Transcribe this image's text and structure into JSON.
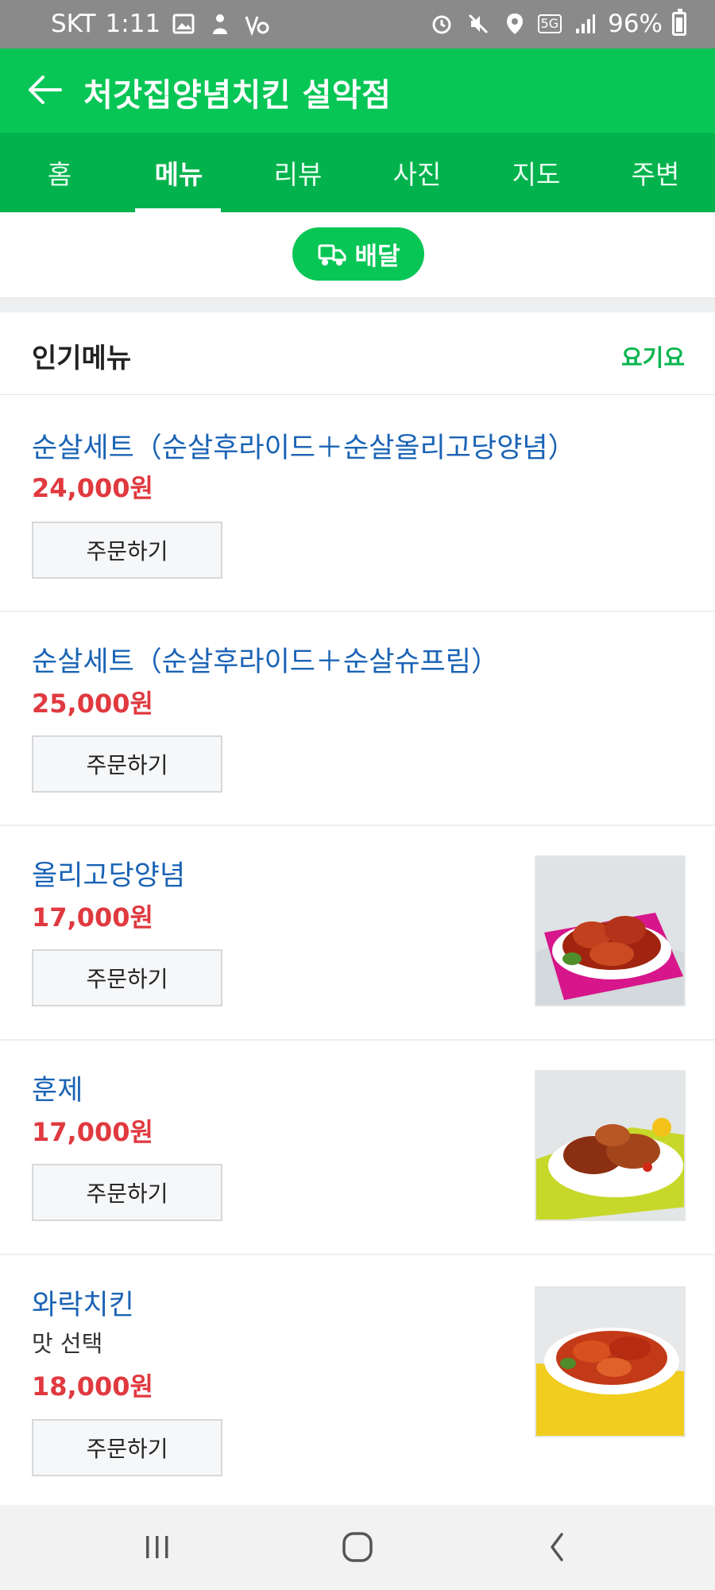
{
  "status_bar": {
    "carrier": "SKT",
    "time": "1:11",
    "network": "5G",
    "battery": "96%"
  },
  "header": {
    "title": "처갓집양념치킨 설악점"
  },
  "tabs": [
    {
      "label": "홈"
    },
    {
      "label": "메뉴"
    },
    {
      "label": "리뷰"
    },
    {
      "label": "사진"
    },
    {
      "label": "지도"
    },
    {
      "label": "주변"
    }
  ],
  "delivery": {
    "label": "배달"
  },
  "section": {
    "title": "인기메뉴",
    "source": "요기요"
  },
  "menu": [
    {
      "name": "순살세트（순살후라이드＋순살올리고당양념）",
      "subtitle": "",
      "price": "24,000원",
      "order_label": "주문하기",
      "image": "none"
    },
    {
      "name": "순살세트（순살후라이드＋순살슈프림）",
      "subtitle": "",
      "price": "25,000원",
      "order_label": "주문하기",
      "image": "none"
    },
    {
      "name": "올리고당양념",
      "subtitle": "",
      "price": "17,000원",
      "order_label": "주문하기",
      "image": "seasoned-chicken-on-pink-cloth"
    },
    {
      "name": "훈제",
      "subtitle": "",
      "price": "17,000원",
      "order_label": "주문하기",
      "image": "smoked-chicken-on-yellow-cloth"
    },
    {
      "name": "와락치킨",
      "subtitle": "맛 선택",
      "price": "18,000원",
      "order_label": "주문하기",
      "image": "spicy-chicken-on-yellow-cloth"
    }
  ],
  "colors": {
    "brand_green": "#08c656",
    "tab_green": "#02b24d",
    "item_name_blue": "#1a63b5",
    "price_red": "#e0393f"
  }
}
